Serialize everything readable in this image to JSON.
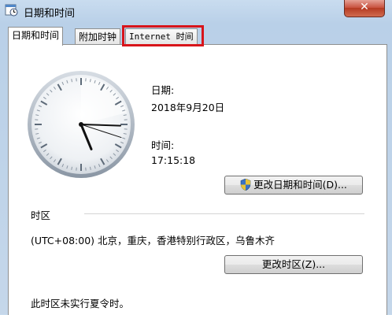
{
  "window": {
    "title": "日期和时间",
    "close_label": "✕"
  },
  "tabs": [
    {
      "label": "日期和时间"
    },
    {
      "label": "附加时钟"
    },
    {
      "label": "Internet 时间"
    }
  ],
  "clock": {
    "hour": 5,
    "minute": 15,
    "second": 18
  },
  "date": {
    "label": "日期:",
    "value": "2018年9月20日"
  },
  "time": {
    "label": "时间:",
    "value": "17:15:18"
  },
  "buttons": {
    "change_datetime": "更改日期和时间(D)...",
    "change_timezone": "更改时区(Z)..."
  },
  "timezone": {
    "section_label": "时区",
    "value": "(UTC+08:00) 北京，重庆，香港特别行政区，乌鲁木齐",
    "dst_note": "此时区未实行夏令时。"
  },
  "icons": {
    "window": "calendar-clock-icon",
    "uac": "uac-shield-icon"
  }
}
